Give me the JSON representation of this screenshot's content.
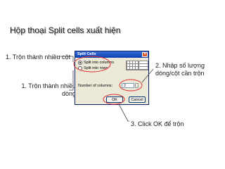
{
  "slide": {
    "title": "Hộp thoại Split cells xuất hiện",
    "notes": {
      "columns_radio": "1. Trộn thành nhiều cột",
      "number_field_line1": "2. Nhập số lượng",
      "number_field_line2": "dòng/cột cần trộn",
      "rows_radio": "1. Trộn thành nhiều dòng",
      "ok_button": "3. Click OK để trộn"
    }
  },
  "dialog": {
    "title": "Split Cells",
    "close_icon": "close-icon",
    "options": [
      {
        "label": "Split into columns",
        "selected": true
      },
      {
        "label": "Split into rows",
        "selected": false
      }
    ],
    "number_label": "Number of columns:",
    "number_value": "2",
    "ok_label": "OK",
    "cancel_label": "Cancel"
  },
  "colors": {
    "highlight_ellipse": "#e03030",
    "callout_line": "#444444",
    "titlebar": "#0b3fb0"
  }
}
